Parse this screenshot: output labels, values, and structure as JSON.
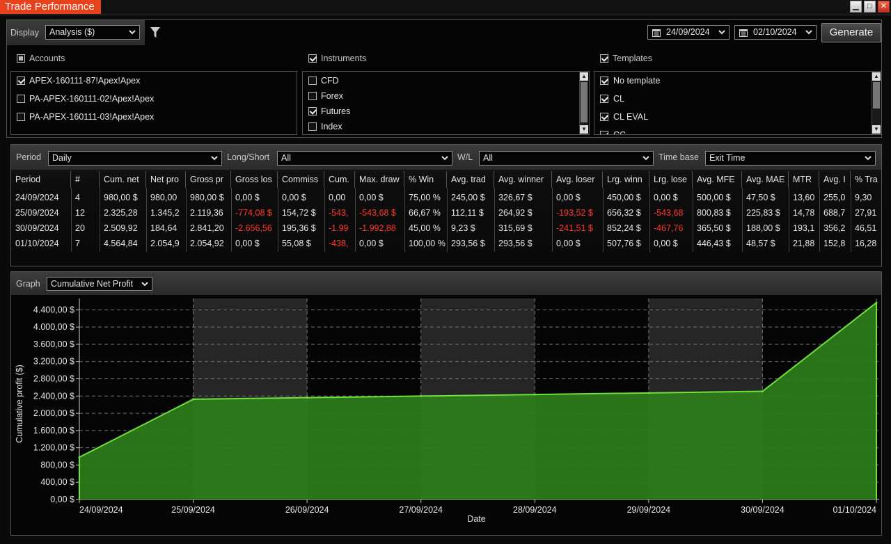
{
  "window": {
    "title": "Trade Performance"
  },
  "toolbar": {
    "display_label": "Display",
    "display_value": "Analysis ($)",
    "date_from": "24/09/2024",
    "date_to": "02/10/2024",
    "generate_label": "Generate"
  },
  "filters": {
    "accounts": {
      "title": "Accounts",
      "items": [
        {
          "label": "APEX-160111-87!Apex!Apex",
          "checked": true
        },
        {
          "label": "PA-APEX-160111-02!Apex!Apex",
          "checked": false
        },
        {
          "label": "PA-APEX-160111-03!Apex!Apex",
          "checked": false
        }
      ]
    },
    "instruments": {
      "title": "Instruments",
      "items": [
        {
          "label": "CFD",
          "checked": false
        },
        {
          "label": "Forex",
          "checked": false
        },
        {
          "label": "Futures",
          "checked": true
        },
        {
          "label": "Index",
          "checked": false
        }
      ]
    },
    "templates": {
      "title": "Templates",
      "items": [
        {
          "label": "No template",
          "checked": true
        },
        {
          "label": "CL",
          "checked": true
        },
        {
          "label": "CL EVAL",
          "checked": true
        },
        {
          "label": "CC",
          "checked": true
        }
      ]
    }
  },
  "grid_filters": {
    "period_label": "Period",
    "period_value": "Daily",
    "longshort_label": "Long/Short",
    "longshort_value": "All",
    "wl_label": "W/L",
    "wl_value": "All",
    "timebase_label": "Time base",
    "timebase_value": "Exit Time"
  },
  "table": {
    "columns": [
      "Period",
      "#",
      "Cum. net",
      "Net pro",
      "Gross pr",
      "Gross los",
      "Commiss",
      "Cum.",
      "Max. draw",
      "% Win",
      "Avg. trad",
      "Avg. winner",
      "Avg. loser",
      "Lrg. winn",
      "Lrg. lose",
      "Avg. MFE",
      "Avg. MAE",
      "MTR",
      "Avg. I",
      "% Tra"
    ],
    "rows": [
      [
        "24/09/2024",
        "4",
        "980,00 $",
        "980,00",
        "980,00 $",
        "0,00 $",
        "0,00 $",
        "0,00",
        "0,00 $",
        "75,00 %",
        "245,00 $",
        "326,67 $",
        "0,00 $",
        "450,00 $",
        "0,00 $",
        "500,00 $",
        "47,50 $",
        "13,60",
        "255,0",
        "9,30"
      ],
      [
        "25/09/2024",
        "12",
        "2.325,28",
        "1.345,2",
        "2.119,36",
        "-774,08 $",
        "154,72 $",
        "-543,",
        "-543,68 $",
        "66,67 %",
        "112,11 $",
        "264,92 $",
        "-193,52 $",
        "656,32 $",
        "-543,68",
        "800,83 $",
        "225,83 $",
        "14,78",
        "688,7",
        "27,91"
      ],
      [
        "30/09/2024",
        "20",
        "2.509,92",
        "184,64",
        "2.841,20",
        "-2.656,56",
        "195,36 $",
        "-1.99",
        "-1.992,88",
        "45,00 %",
        "9,23 $",
        "315,69 $",
        "-241,51 $",
        "852,24 $",
        "-467,76",
        "365,50 $",
        "188,00 $",
        "193,1",
        "356,2",
        "46,51"
      ],
      [
        "01/10/2024",
        "7",
        "4.564,84",
        "2.054,9",
        "2.054,92",
        "0,00 $",
        "55,08 $",
        "-438,",
        "0,00 $",
        "100,00 %",
        "293,56 $",
        "293,56 $",
        "0,00 $",
        "507,76 $",
        "0,00 $",
        "446,43 $",
        "48,57 $",
        "21,88",
        "152,8",
        "16,28"
      ]
    ],
    "negative_cells": [
      [
        1,
        5
      ],
      [
        1,
        7
      ],
      [
        1,
        8
      ],
      [
        1,
        12
      ],
      [
        1,
        14
      ],
      [
        2,
        5
      ],
      [
        2,
        7
      ],
      [
        2,
        8
      ],
      [
        2,
        12
      ],
      [
        2,
        14
      ],
      [
        3,
        7
      ]
    ]
  },
  "graph": {
    "label": "Graph",
    "value": "Cumulative Net Profit"
  },
  "chart_data": {
    "type": "area",
    "title": "",
    "xlabel": "Date",
    "ylabel": "Cumulative profit ($)",
    "x": [
      "24/09/2024",
      "25/09/2024",
      "26/09/2024",
      "27/09/2024",
      "28/09/2024",
      "29/09/2024",
      "30/09/2024",
      "01/10/2024"
    ],
    "y": [
      980,
      2325.28,
      2362,
      2398,
      2435,
      2472,
      2509.92,
      4564.84
    ],
    "yticks": [
      "0,00 $",
      "400,00 $",
      "800,00 $",
      "1.200,00 $",
      "1.600,00 $",
      "2.000,00 $",
      "2.400,00 $",
      "2.800,00 $",
      "3.200,00 $",
      "3.600,00 $",
      "4.000,00 $",
      "4.400,00 $"
    ],
    "ylim": [
      0,
      4600
    ],
    "grid": true,
    "colors": {
      "fill": "#2e7d1a",
      "line": "#6fe040",
      "band": "#262626"
    }
  }
}
